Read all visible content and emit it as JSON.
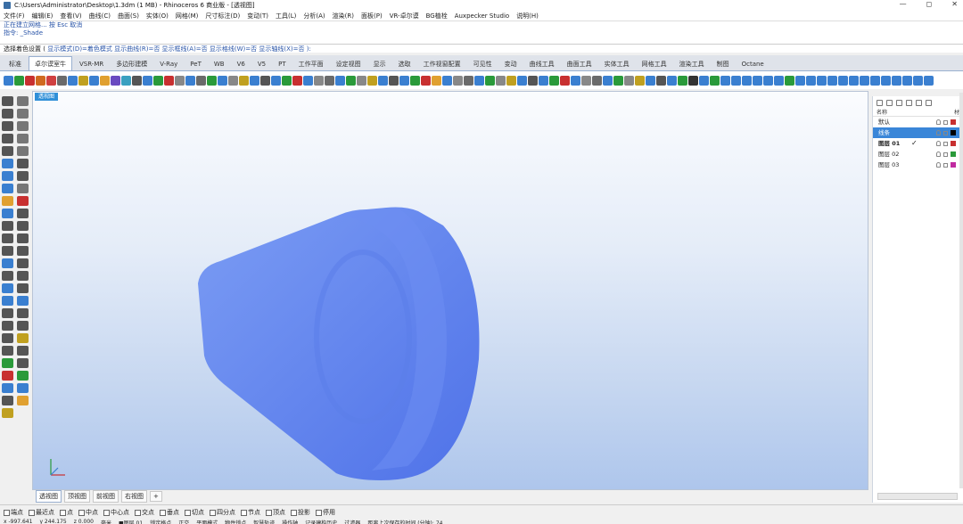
{
  "window": {
    "title": "C:\\Users\\Administrator\\Desktop\\1.3dm (1 MB) - Rhinoceros 6 商业版 - [透视图]",
    "min": "—",
    "max": "◻",
    "close": "✕"
  },
  "menu": [
    "文件(F)",
    "编辑(E)",
    "查看(V)",
    "曲线(C)",
    "曲面(S)",
    "实体(O)",
    "网格(M)",
    "尺寸标注(D)",
    "变动(T)",
    "工具(L)",
    "分析(A)",
    "渲染(R)",
    "面板(P)",
    "VR-卓尔谟",
    "BG植栓",
    "Auxpecker Studio",
    "说明(H)"
  ],
  "command": {
    "history1": "正在建立网格... 按 Esc 取消",
    "history2": "指令: _Shade",
    "prompt_label": "选择着色设置 (",
    "prompt_opts": "显示模式(D)=着色模式 显示曲线(R)=否 显示框线(A)=否 显示格线(W)=否 显示轴线(X)=否 ):"
  },
  "tabs": [
    {
      "label": "标准"
    },
    {
      "label": "卓尔谟室牛",
      "active": true
    },
    {
      "label": "VSR-MR"
    },
    {
      "label": "多边形建模"
    },
    {
      "label": "V-Ray"
    },
    {
      "label": "PeT"
    },
    {
      "label": "WB"
    },
    {
      "label": "V6"
    },
    {
      "label": "V5"
    },
    {
      "label": "PT"
    },
    {
      "label": "工作平面"
    },
    {
      "label": "设定视图"
    },
    {
      "label": "显示"
    },
    {
      "label": "选取"
    },
    {
      "label": "工作视窗配置"
    },
    {
      "label": "可见性"
    },
    {
      "label": "变动"
    },
    {
      "label": "曲线工具"
    },
    {
      "label": "曲面工具"
    },
    {
      "label": "实体工具"
    },
    {
      "label": "网格工具"
    },
    {
      "label": "渲染工具"
    },
    {
      "label": "制图"
    },
    {
      "label": "Octane"
    }
  ],
  "toolbar_colors": [
    "#3a7fd0",
    "#2a9a3a",
    "#c83030",
    "#d06a20",
    "#d04040",
    "#6a6a6a",
    "#3a7fd0",
    "#c0a020",
    "#3a7fd0",
    "#e0a030",
    "#6a4ac0",
    "#3aa0c0",
    "#555555",
    "#3a7fd0",
    "#2a9a3a",
    "#c83030",
    "#888888",
    "#3a7fd0",
    "#6a6a6a",
    "#2a9a3a",
    "#3a7fd0",
    "#888888",
    "#c0a020",
    "#3a7fd0",
    "#555555",
    "#3a7fd0",
    "#2a9a3a",
    "#c83030",
    "#3a7fd0",
    "#888888",
    "#6a6a6a",
    "#3a7fd0",
    "#2a9a3a",
    "#888888",
    "#c0a020",
    "#3a7fd0",
    "#555555",
    "#3a7fd0",
    "#2a9a3a",
    "#c83030",
    "#e0a030",
    "#3a7fd0",
    "#888888",
    "#6a6a6a",
    "#3a7fd0",
    "#2a9a3a",
    "#888888",
    "#c0a020",
    "#3a7fd0",
    "#555555",
    "#3a7fd0",
    "#2a9a3a",
    "#c83030",
    "#3a7fd0",
    "#888888",
    "#6a6a6a",
    "#3a7fd0",
    "#2a9a3a",
    "#888888",
    "#c0a020",
    "#3a7fd0",
    "#555555",
    "#3a7fd0",
    "#2a9a3a",
    "#333333",
    "#3a7fd0",
    "#2a9a3a",
    "#3a7fd0",
    "#3a7fd0",
    "#3a7fd0",
    "#3a7fd0",
    "#3a7fd0",
    "#3a7fd0",
    "#2a9a3a",
    "#3a7fd0",
    "#3a7fd0",
    "#3a7fd0",
    "#3a7fd0",
    "#3a7fd0",
    "#3a7fd0",
    "#3a7fd0",
    "#3a7fd0",
    "#3a7fd0",
    "#3a7fd0",
    "#3a7fd0",
    "#3a7fd0",
    "#3a7fd0"
  ],
  "left_tool_colors": [
    "#555555",
    "#777777",
    "#555555",
    "#777777",
    "#555555",
    "#777777",
    "#555555",
    "#777777",
    "#555555",
    "#777777",
    "#3a7fd0",
    "#555555",
    "#3a7fd0",
    "#555555",
    "#3a7fd0",
    "#777777",
    "#e0a030",
    "#c83030",
    "#3a7fd0",
    "#555555",
    "#555555",
    "#555555",
    "#555555",
    "#555555",
    "#555555",
    "#555555",
    "#3a7fd0",
    "#555555",
    "#555555",
    "#555555",
    "#3a7fd0",
    "#555555",
    "#3a7fd0",
    "#3a7fd0",
    "#555555",
    "#555555",
    "#555555",
    "#555555",
    "#555555",
    "#c0a020",
    "#555555",
    "#555555",
    "#2a9a3a",
    "#555555",
    "#c83030",
    "#2a9a3a",
    "#3a7fd0",
    "#3a7fd0",
    "#555555",
    "#e0a030",
    "#c0a020"
  ],
  "viewport": {
    "label": "透视图",
    "model_color": "#6688f0"
  },
  "viewport_tabs": [
    {
      "label": "透视图",
      "selected": true
    },
    {
      "label": "顶视图"
    },
    {
      "label": "前视图"
    },
    {
      "label": "右视图"
    },
    {
      "label": "+"
    }
  ],
  "layers": {
    "header_name": "名称",
    "header_mat": "材",
    "items": [
      {
        "name": "默认",
        "color": "#c83030"
      },
      {
        "name": "线条",
        "color": "#000000",
        "selected": true
      },
      {
        "name": "图层 01",
        "color": "#c83030",
        "current": true,
        "bold": true
      },
      {
        "name": "图层 02",
        "color": "#2a9a3a"
      },
      {
        "name": "图层 03",
        "color": "#c02aa0"
      }
    ]
  },
  "osnap": [
    {
      "label": "端点",
      "checked": false
    },
    {
      "label": "最近点",
      "checked": false
    },
    {
      "label": "点",
      "checked": false
    },
    {
      "label": "中点",
      "checked": false
    },
    {
      "label": "中心点",
      "checked": false
    },
    {
      "label": "交点",
      "checked": false
    },
    {
      "label": "垂点",
      "checked": false
    },
    {
      "label": "切点",
      "checked": false
    },
    {
      "label": "四分点",
      "checked": false
    },
    {
      "label": "节点",
      "checked": false
    },
    {
      "label": "顶点",
      "checked": false
    },
    {
      "label": "投影",
      "checked": false
    },
    {
      "label": "停用",
      "checked": false
    }
  ],
  "status": {
    "coords": [
      "x -997.641",
      "y 244.175",
      "z 0.000",
      "毫米",
      "■图层 01",
      "锁定格点",
      "正交",
      "平面模式",
      "物件锁点",
      "智慧轨迹",
      "操作轴",
      "记录建构历史",
      "过滤器",
      "距离上次保存的时间 (分钟): 74"
    ]
  }
}
